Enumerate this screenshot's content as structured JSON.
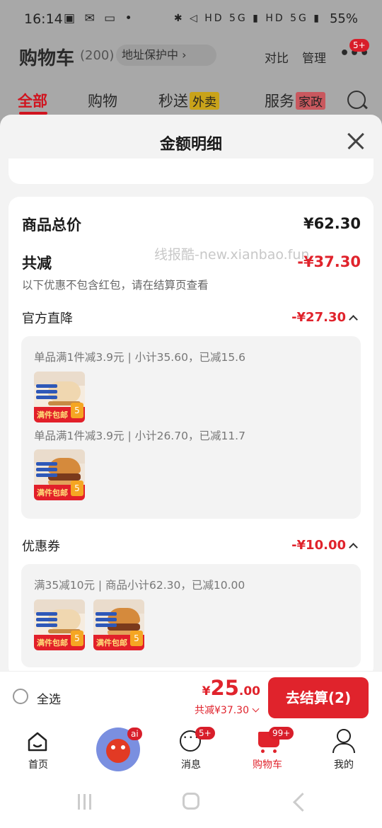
{
  "status": {
    "time": "16:14",
    "left_icons": "▣ ✉ ▭ •",
    "right_icons": "✱ ◁ HD 5G ▮ HD 5G ▮",
    "battery": "55%"
  },
  "cart_header": {
    "title": "购物车",
    "count": "(200)",
    "address_label": "地址保护中 ›",
    "compare": "对比",
    "manage": "管理",
    "more_badge": "5+"
  },
  "tabs": [
    {
      "label": "全部"
    },
    {
      "label": "购物"
    },
    {
      "label": "秒送",
      "tag": "外卖"
    },
    {
      "label": "服务",
      "tag": "家政"
    }
  ],
  "sheet": {
    "title": "金额明细",
    "total_label": "商品总价",
    "total_value": "¥62.30",
    "discount_label": "共减",
    "discount_value": "-¥37.30",
    "note": "以下优惠不包含红包，请在结算页查看",
    "watermark": "线报酷-new.xianbao.fun",
    "official_label": "官方直降",
    "official_value": "-¥27.30",
    "official_lines": [
      "单品满1件减3.9元 | 小计35.60，已减15.6",
      "单品满1件减3.9元 | 小计26.70，已减11.7"
    ],
    "coupon_label": "优惠券",
    "coupon_value": "-¥10.00",
    "coupon_line": "满35减10元 | 商品小计62.30，已减10.00",
    "promo_text": "满件包邮",
    "promo_num": "5"
  },
  "checkout": {
    "select_all": "全选",
    "currency": "¥",
    "price_int": "25",
    "price_dec": ".00",
    "saved": "共减¥37.30",
    "button": "去结算(2)"
  },
  "tabbar": {
    "home": "首页",
    "ai_badge": "ai",
    "messages": "消息",
    "messages_badge": "5+",
    "cart": "购物车",
    "cart_badge": "99+",
    "mine": "我的"
  },
  "colors": {
    "accent": "#e0232c",
    "sheet_bg": "#f3f3f3"
  }
}
